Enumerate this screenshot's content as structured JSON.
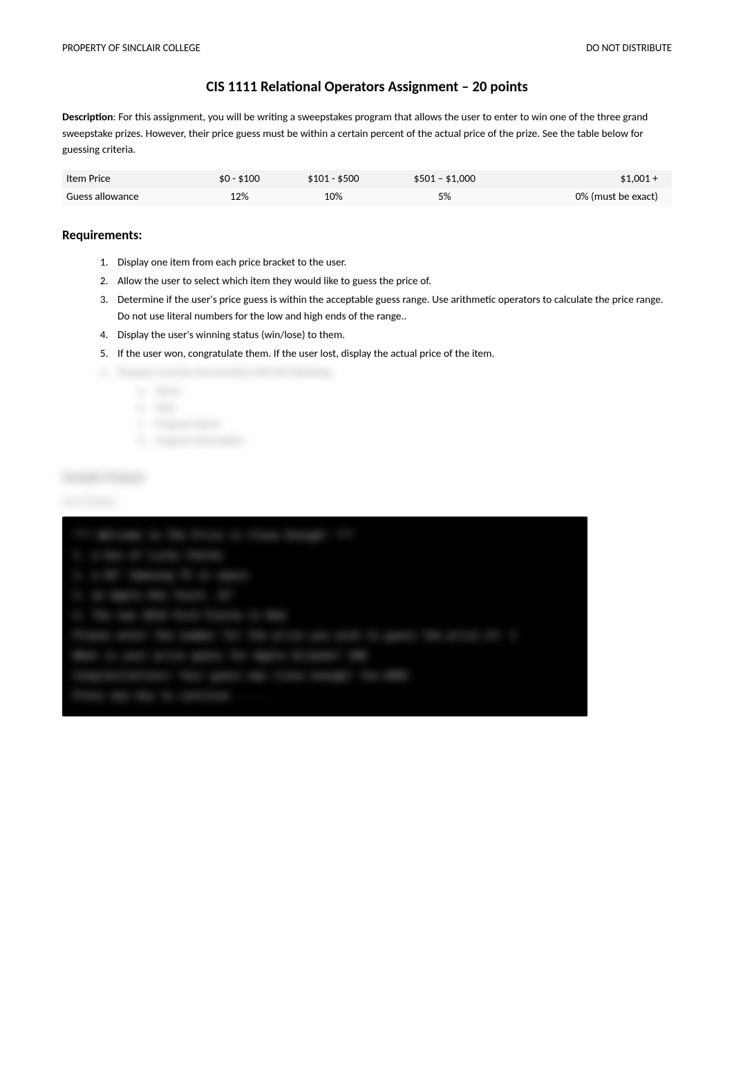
{
  "header": {
    "left": "PROPERTY OF SINCLAIR COLLEGE",
    "right": "DO NOT DISTRIBUTE"
  },
  "title": "CIS 1111 Relational Operators Assignment – 20 points",
  "description": {
    "label": "Description",
    "text": ": For this assignment, you will be writing a sweepstakes program that allows the user to enter to win one of the three grand sweepstake prizes. However, their price guess must be within a certain percent of the actual price of the prize. See the table below for guessing criteria."
  },
  "table": {
    "row1": {
      "label": "Item Price",
      "c1": "$0 - $100",
      "c2": "$101 - $500",
      "c3": "$501 – $1,000",
      "c4": "$1,001 +"
    },
    "row2": {
      "label": "Guess allowance",
      "c1": "12%",
      "c2": "10%",
      "c3": "5%",
      "c4": "0% (must be exact)"
    }
  },
  "requirements": {
    "heading": "Requirements:",
    "items": {
      "r1": "Display one item from each price bracket to the user.",
      "r2": "Allow the user to select which item they would like to guess the price of.",
      "r3": "Determine if the user's price guess is within the acceptable guess range.  Use arithmetic operators to calculate the price range.  Do not use literal numbers for the low and high ends of the range..",
      "r4": "Display the user's winning status (win/lose) to them.",
      "r5": "If the user won, congratulate them. If the user lost, display the actual price of the item.",
      "r6": "Program must be documented with the following",
      "sub": {
        "a": "Name",
        "b": "Date",
        "c": "Program Name",
        "d": "Program Description"
      }
    }
  },
  "sample": {
    "heading": "Sample Output",
    "subheading": "User Output",
    "console": {
      "l1": "*** Welcome to The Price is Close Enough! ***",
      "l2": " ",
      "l3": "1. a box of Lucky Charms",
      "l4": "2. a 65\" Samsung TV in space",
      "l5": "3. an Apple One Touch, 15\"",
      "l6": "4. The new 2019 Ford Fiesta in Red",
      "l7": " ",
      "l8": "Please enter the number for the prize you wish to guess the price of:  1",
      "l9": " ",
      "l10": "What is your price guess for Apple Airpods?  100",
      "l11": " ",
      "l12": "Congratulations! Your guess was close enough! You WIN!",
      "l13": " ",
      "l14": "Press any key to continue . . ."
    }
  }
}
